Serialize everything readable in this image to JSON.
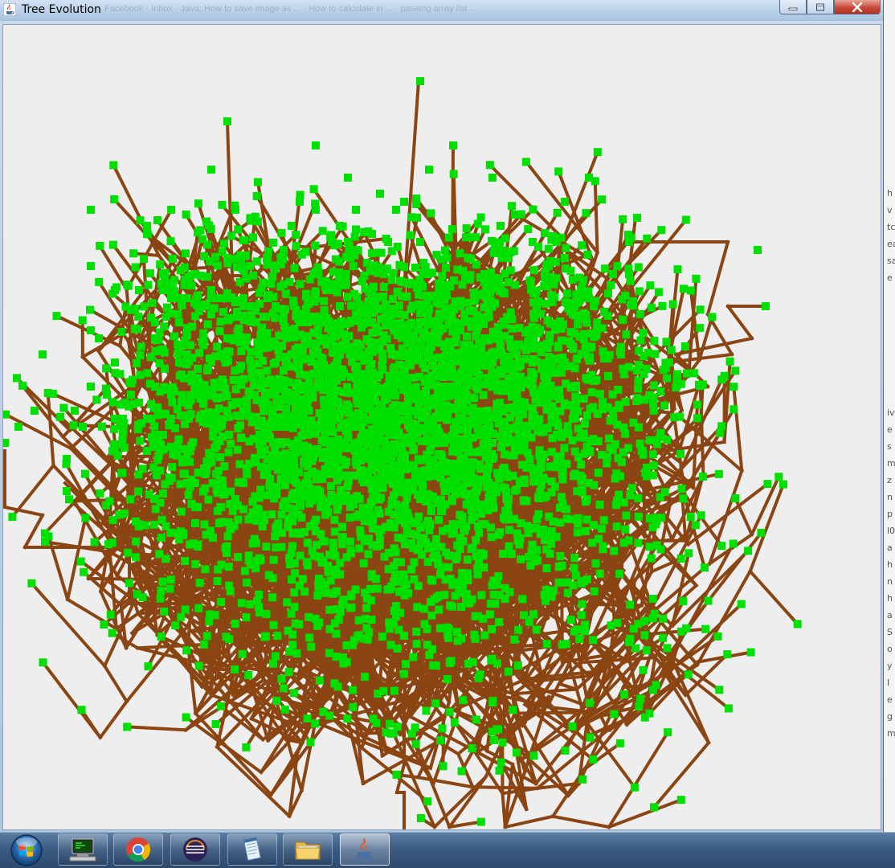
{
  "window": {
    "title": "Tree Evolution",
    "title_behind": "Facebook   ·   Inbox   ·   Java: How to save image as ...   ·   How to calculate in ...   ·   passing array list ...",
    "controls": {
      "minimize": "minimize",
      "maximize": "maximize",
      "close": "close"
    }
  },
  "canvas": {
    "background": "#eeeeee",
    "branch_color": "#8b4513",
    "leaf_color": "#00e000",
    "trunk_base": [
      502,
      1030
    ]
  },
  "background_window": {
    "edge_glyphs": [
      "h",
      "v",
      "tc",
      "ea",
      "sa",
      "e",
      "",
      "",
      "",
      "",
      "",
      "",
      "",
      "iv",
      "e",
      "s",
      "m",
      "z",
      "n",
      "p",
      "l0",
      "a",
      "h",
      "n",
      "h",
      "a",
      "S",
      "o",
      "y",
      "I",
      "e",
      "g",
      "m"
    ]
  },
  "taskbar": {
    "start": "start-orb",
    "items": [
      {
        "name": "terminal-task",
        "icon": "terminal-icon",
        "active": false
      },
      {
        "name": "chrome-task",
        "icon": "chrome-icon",
        "active": false
      },
      {
        "name": "eclipse-task",
        "icon": "eclipse-icon",
        "active": false
      },
      {
        "name": "notepad-task",
        "icon": "notepad-icon",
        "active": false
      },
      {
        "name": "explorer-task",
        "icon": "folder-icon",
        "active": false
      },
      {
        "name": "java-task",
        "icon": "java-icon",
        "active": true
      }
    ]
  }
}
